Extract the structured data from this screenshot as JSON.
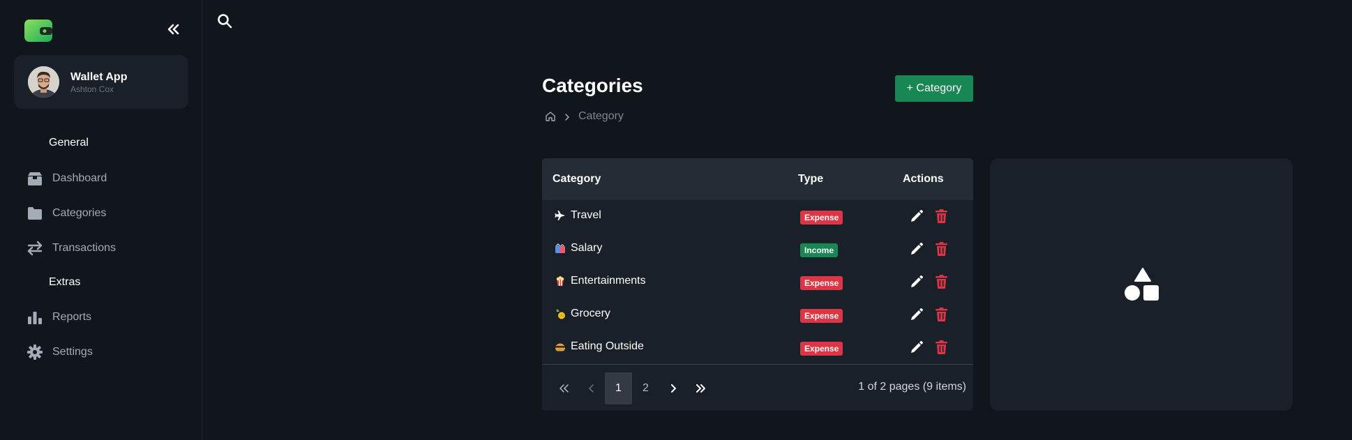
{
  "sidebar": {
    "profile": {
      "name": "Wallet App",
      "subtitle": "Ashton Cox"
    },
    "sections": [
      {
        "title": "General",
        "items": [
          {
            "label": "Dashboard",
            "icon": "box-icon"
          },
          {
            "label": "Categories",
            "icon": "folder-icon"
          },
          {
            "label": "Transactions",
            "icon": "swap-arrows-icon"
          }
        ]
      },
      {
        "title": "Extras",
        "items": [
          {
            "label": "Reports",
            "icon": "bar-chart-icon"
          },
          {
            "label": "Settings",
            "icon": "gear-icon"
          }
        ]
      }
    ]
  },
  "page": {
    "title": "Categories",
    "add_button": "+ Category",
    "breadcrumb": {
      "current": "Category"
    }
  },
  "table": {
    "headers": {
      "category": "Category",
      "type": "Type",
      "actions": "Actions"
    },
    "rows": [
      {
        "icon": "airplane-icon",
        "name": "Travel",
        "type": "Expense"
      },
      {
        "icon": "shopping-bags-icon",
        "name": "Salary",
        "type": "Income"
      },
      {
        "icon": "popcorn-icon",
        "name": "Entertainments",
        "type": "Expense"
      },
      {
        "icon": "pineapple-icon",
        "name": "Grocery",
        "type": "Expense"
      },
      {
        "icon": "burger-icon",
        "name": "Eating Outside",
        "type": "Expense"
      }
    ]
  },
  "pagination": {
    "first": "«",
    "prev": "‹",
    "pages": [
      "1",
      "2"
    ],
    "next": "›",
    "last": "»",
    "current_page": "1",
    "info": "1 of 2 pages (9 items)"
  },
  "colors": {
    "background": "#11161d",
    "card": "#1a2029",
    "accent_green": "#198754",
    "expense_red": "#dc3545",
    "logo_gradient": [
      "#7ed957",
      "#1faa5a"
    ]
  }
}
